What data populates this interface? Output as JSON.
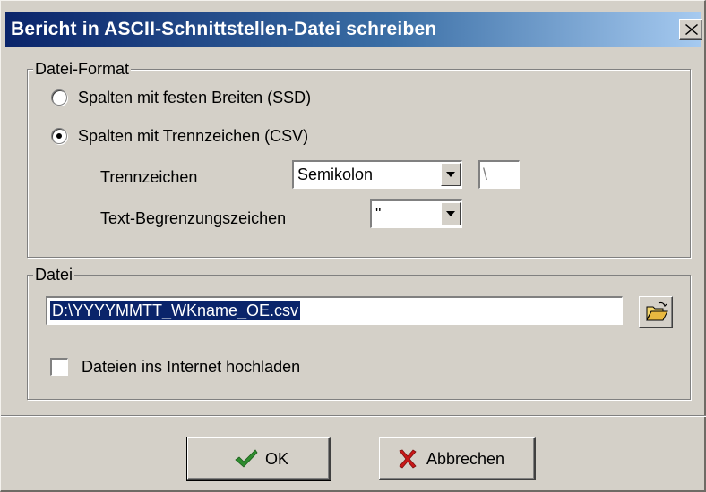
{
  "window": {
    "title": "Bericht in ASCII-Schnittstellen-Datei schreiben",
    "close_icon": "close-x"
  },
  "format_group": {
    "legend": "Datei-Format",
    "options": [
      {
        "label": "Spalten mit festen Breiten (SSD)",
        "selected": false
      },
      {
        "label": "Spalten mit Trennzeichen (CSV)",
        "selected": true
      }
    ],
    "separator": {
      "label": "Trennzeichen",
      "value": "Semikolon",
      "custom_value": "\\"
    },
    "text_delimiter": {
      "label": "Text-Begrenzungszeichen",
      "value": "\""
    }
  },
  "file_group": {
    "legend": "Datei",
    "path": "D:\\YYYYMMTT_WKname_OE.csv",
    "browse_icon": "folder-open",
    "upload": {
      "label": "Dateien ins Internet hochladen",
      "checked": false
    }
  },
  "buttons": {
    "ok": "OK",
    "cancel": "Abbrechen"
  },
  "colors": {
    "title_start": "#0a246a",
    "title_end": "#a6caf0",
    "face": "#d4d0c8",
    "selection": "#0a246a",
    "ok_check": "#2e8b2e",
    "cancel_x": "#c81818"
  }
}
